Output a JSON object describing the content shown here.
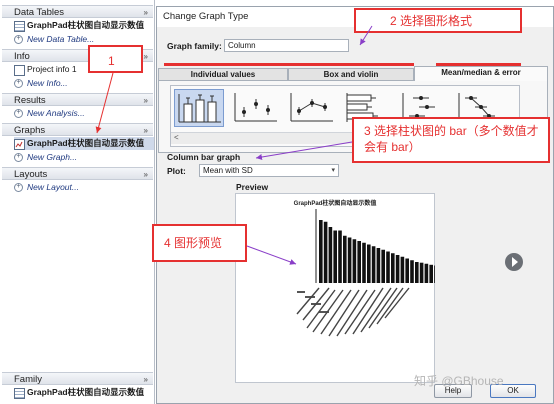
{
  "nav": {
    "sections": [
      {
        "title": "Data Tables",
        "items": [
          {
            "label": "GraphPad柱状图自动显示数值",
            "kind": "table",
            "bold": true
          },
          {
            "label": "New Data Table...",
            "kind": "new"
          }
        ]
      },
      {
        "title": "Info",
        "items": [
          {
            "label": "Project info 1",
            "kind": "info"
          },
          {
            "label": "New Info...",
            "kind": "new"
          }
        ]
      },
      {
        "title": "Results",
        "items": [
          {
            "label": "New Analysis...",
            "kind": "new"
          }
        ]
      },
      {
        "title": "Graphs",
        "items": [
          {
            "label": "GraphPad柱状图自动显示数值",
            "kind": "graph",
            "bold": true,
            "selected": true
          },
          {
            "label": "New Graph...",
            "kind": "new"
          }
        ]
      },
      {
        "title": "Layouts",
        "items": [
          {
            "label": "New Layout...",
            "kind": "new"
          }
        ]
      }
    ],
    "family": {
      "title": "Family",
      "item": "GraphPad柱状图自动显示数值"
    },
    "chevron": "»"
  },
  "dialog": {
    "title": "Change Graph Type",
    "graph_family_label": "Graph family:",
    "graph_family_value": "Column",
    "tabs": [
      {
        "label": "Individual values",
        "active": false
      },
      {
        "label": "Box and violin",
        "active": false
      },
      {
        "label": "Mean/median & error",
        "active": true
      }
    ],
    "thumbnails": [
      "column-bar-sd-icon",
      "mean-dot-error-icon",
      "connected-mean-error-icon",
      "horizontal-bar-error-icon",
      "mean-dot-error-horizontal-icon",
      "connected-horizontal-error-icon"
    ],
    "scroll_left": "<",
    "graph_type_name": "Column bar graph",
    "plot_label": "Plot:",
    "plot_value": "Mean with SD",
    "preview_label": "Preview",
    "preview_title": "GraphPad柱状图自动显示数值",
    "help": "Help",
    "ok": "OK"
  },
  "annotations": {
    "a1": "1",
    "a2": "2  选择图形格式",
    "a3": "3  选择柱状图的 bar（多个数值才会有 bar）",
    "a4": "4  图形预览"
  },
  "watermark": "知乎 @GBhouse",
  "colors": {
    "accent_red": "#e53030",
    "arrow_purple": "#8a3fc8",
    "selection": "#cfd9ea"
  },
  "chart_data": {
    "type": "bar",
    "title": "GraphPad柱状图自动显示数值",
    "values": [
      18,
      17.5,
      16,
      15,
      15,
      13.5,
      13,
      12.5,
      12,
      11.5,
      11,
      10.5,
      10,
      9.5,
      9,
      8.5,
      8,
      7.5,
      7,
      6.5,
      6,
      5.8,
      5.5,
      5.2,
      5
    ],
    "ylim": [
      0,
      20
    ]
  }
}
